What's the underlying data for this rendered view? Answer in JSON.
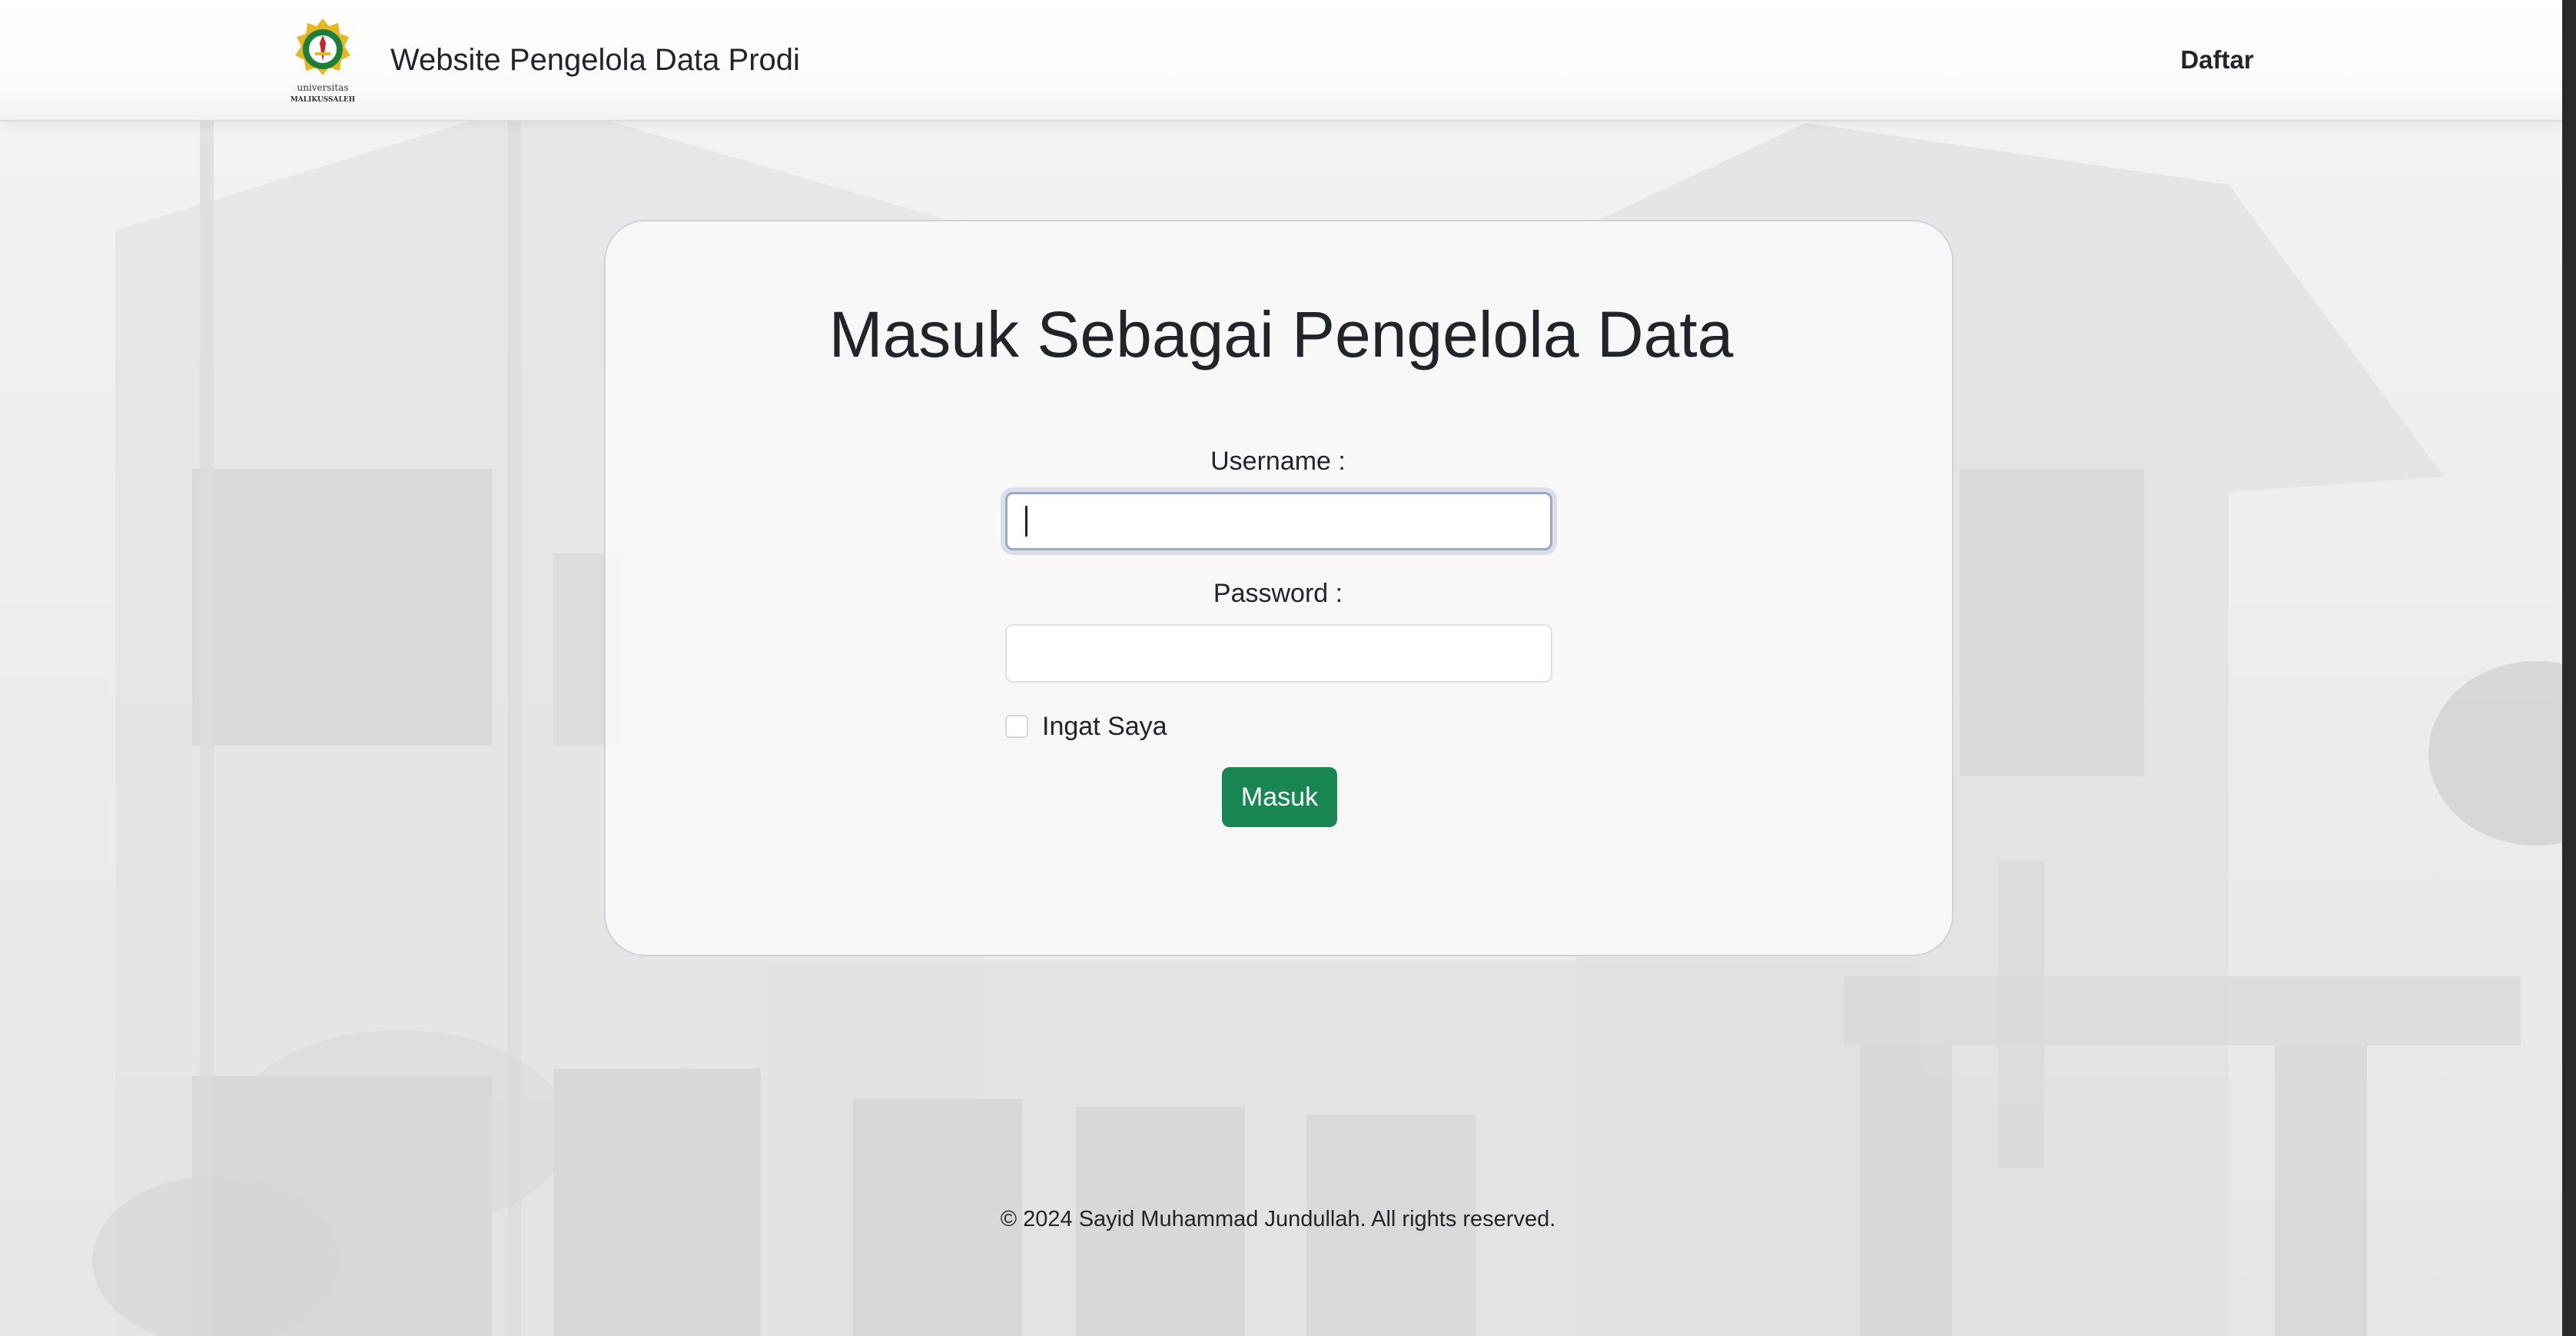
{
  "navbar": {
    "logo_icon": "universitas-malikussaleh-logo",
    "logo_text_top": "universitas",
    "logo_text_bottom": "MALIKUSSALEH",
    "title": "Website Pengelola Data Prodi",
    "register_link": "Daftar"
  },
  "login": {
    "heading": "Masuk Sebagai Pengelola Data",
    "username_label": "Username :",
    "username_value": "",
    "password_label": "Password :",
    "password_value": "",
    "remember_label": "Ingat Saya",
    "remember_checked": false,
    "submit_label": "Masuk",
    "submit_color": "#198754"
  },
  "footer": {
    "copyright": "© 2024 Sayid Muhammad Jundullah. All rights reserved."
  }
}
